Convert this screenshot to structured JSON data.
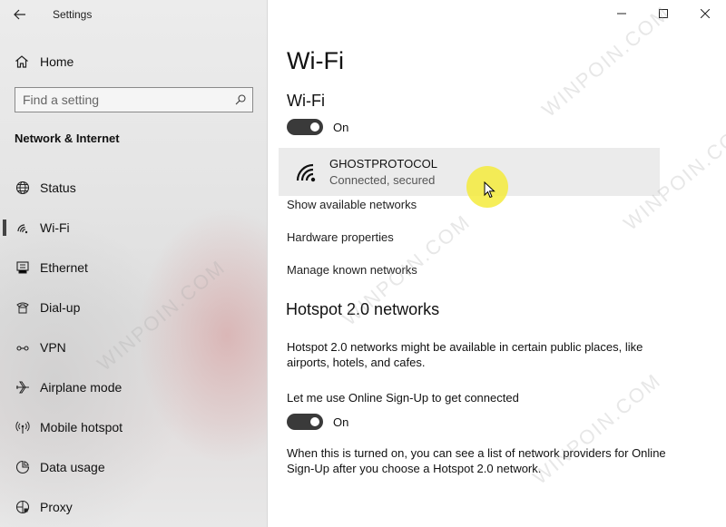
{
  "window": {
    "title": "Settings",
    "controls": {
      "minimize": "—",
      "maximize": "☐",
      "close": "✕"
    }
  },
  "sidebar": {
    "home_label": "Home",
    "search_placeholder": "Find a setting",
    "section_title": "Network & Internet",
    "items": [
      {
        "label": "Status",
        "icon": "globe-icon"
      },
      {
        "label": "Wi-Fi",
        "icon": "wifi-icon",
        "selected": true
      },
      {
        "label": "Ethernet",
        "icon": "ethernet-icon"
      },
      {
        "label": "Dial-up",
        "icon": "dialup-icon"
      },
      {
        "label": "VPN",
        "icon": "vpn-icon"
      },
      {
        "label": "Airplane mode",
        "icon": "airplane-icon"
      },
      {
        "label": "Mobile hotspot",
        "icon": "hotspot-icon"
      },
      {
        "label": "Data usage",
        "icon": "data-usage-icon"
      },
      {
        "label": "Proxy",
        "icon": "proxy-icon"
      }
    ]
  },
  "main": {
    "page_title": "Wi-Fi",
    "wifi_section_title": "Wi-Fi",
    "wifi_toggle_label": "On",
    "network": {
      "name": "GHOSTPROTOCOL",
      "status": "Connected, secured"
    },
    "links": {
      "show_networks": "Show available networks",
      "hardware": "Hardware properties",
      "manage": "Manage known networks"
    },
    "hotspot": {
      "title": "Hotspot 2.0 networks",
      "description": "Hotspot 2.0 networks might be available in certain public places, like airports, hotels, and cafes.",
      "signup_label": "Let me use Online Sign-Up to get connected",
      "signup_toggle_label": "On",
      "footer": "When this is turned on, you can see a list of network providers for Online Sign-Up after you choose a Hotspot 2.0 network."
    }
  },
  "watermark": "WINPOIN.COM",
  "colors": {
    "accent_toggle": "#3a3a3a",
    "cursor_highlight": "#f5eb3c"
  }
}
